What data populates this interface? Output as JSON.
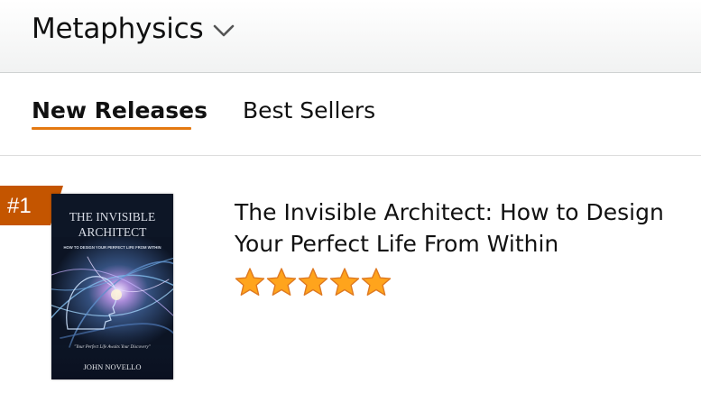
{
  "header": {
    "category_label": "Metaphysics",
    "chevron_icon": "chevron-down-icon"
  },
  "tabs": [
    {
      "label": "New Releases",
      "active": true
    },
    {
      "label": "Best Sellers",
      "active": false
    }
  ],
  "product": {
    "rank": "#1",
    "title": "The Invisible Architect: How to Design Your Perfect Life From Within",
    "rating": 5,
    "rating_max": 5,
    "cover": {
      "title_line1": "THE INVISIBLE",
      "title_line2": "ARCHITECT",
      "subtitle": "HOW TO DESIGN YOUR PERFECT LIFE FROM WITHIN",
      "tagline": "\"Your Perfect Life Awaits Your Discovery\"",
      "author": "JOHN NOVELLO"
    }
  },
  "colors": {
    "accent_orange": "#e47911",
    "rank_badge": "#c45500",
    "star_fill": "#ffa41c"
  }
}
